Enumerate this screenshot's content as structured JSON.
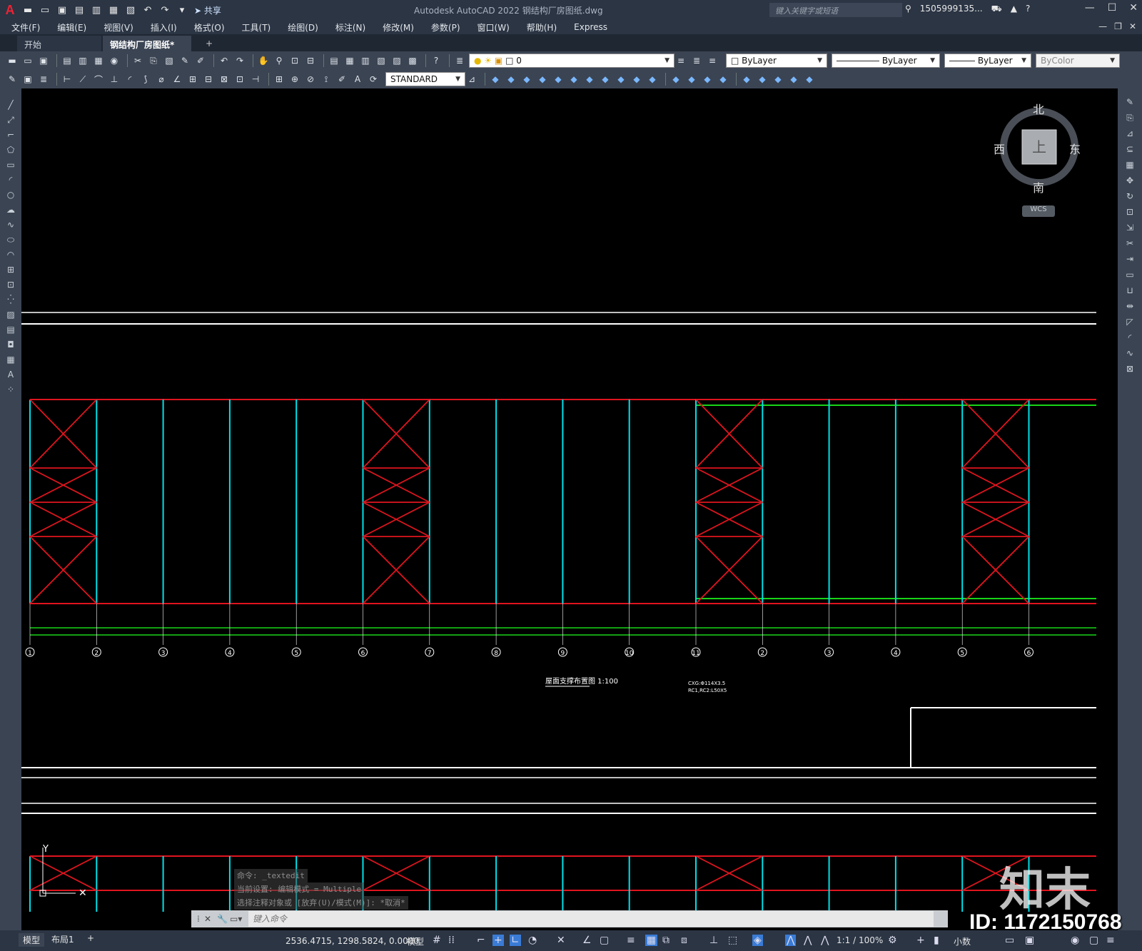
{
  "title_bar": {
    "app_logo": "A",
    "share_label": "共享",
    "title": "Autodesk AutoCAD 2022    钢结构厂房图纸.dwg",
    "search_placeholder": "键入关键字或短语",
    "user": "1505999135...",
    "window_controls": [
      "—",
      "☐",
      "✕"
    ]
  },
  "menu": {
    "items": [
      "文件(F)",
      "编辑(E)",
      "视图(V)",
      "插入(I)",
      "格式(O)",
      "工具(T)",
      "绘图(D)",
      "标注(N)",
      "修改(M)",
      "参数(P)",
      "窗口(W)",
      "帮助(H)",
      "Express"
    ]
  },
  "tabs": {
    "start": "开始",
    "file": "钢结构厂房图纸*",
    "close": "✕",
    "add": "+"
  },
  "toolbar1": {
    "layer_value": "0",
    "color_value": "ByLayer",
    "linetype_value": "ByLayer",
    "lineweight_value": "ByLayer",
    "plotstyle_value": "ByColor"
  },
  "toolbar2": {
    "text_style": "STANDARD"
  },
  "viewcube": {
    "north": "北",
    "south": "南",
    "east": "东",
    "west": "西",
    "top": "上",
    "wcs": "WCS"
  },
  "drawing": {
    "grid_labels": [
      "1",
      "2",
      "3",
      "4",
      "5",
      "6",
      "7",
      "8",
      "9",
      "10",
      "11",
      "2",
      "3",
      "4",
      "5",
      "6"
    ],
    "plan_title": "屋面支撑布置图 1:100",
    "note_line1": "CXG:Φ114X3.5",
    "note_line2": "RC1,RC2:L50X5",
    "ucs_y": "Y"
  },
  "command": {
    "history": [
      "命令: _textedit",
      "当前设置: 编辑模式 = Multiple",
      "选择注释对象或 [放弃(U)/模式(M)]: *取消*"
    ],
    "placeholder": "键入命令"
  },
  "status": {
    "model_tab": "模型",
    "layout_tab": "布局1",
    "add": "+",
    "coords": "2536.4715, 1298.5824, 0.0000",
    "model_label": "模型",
    "scale": "1:1 / 100%",
    "units": "小数"
  },
  "watermark": {
    "logo": "知末",
    "id": "ID: 1172150768"
  },
  "colors": {
    "frame_red": "#e0141e",
    "column_cyan": "#00e0e8",
    "beam_green": "#18d418",
    "line_white": "#ffffff"
  }
}
